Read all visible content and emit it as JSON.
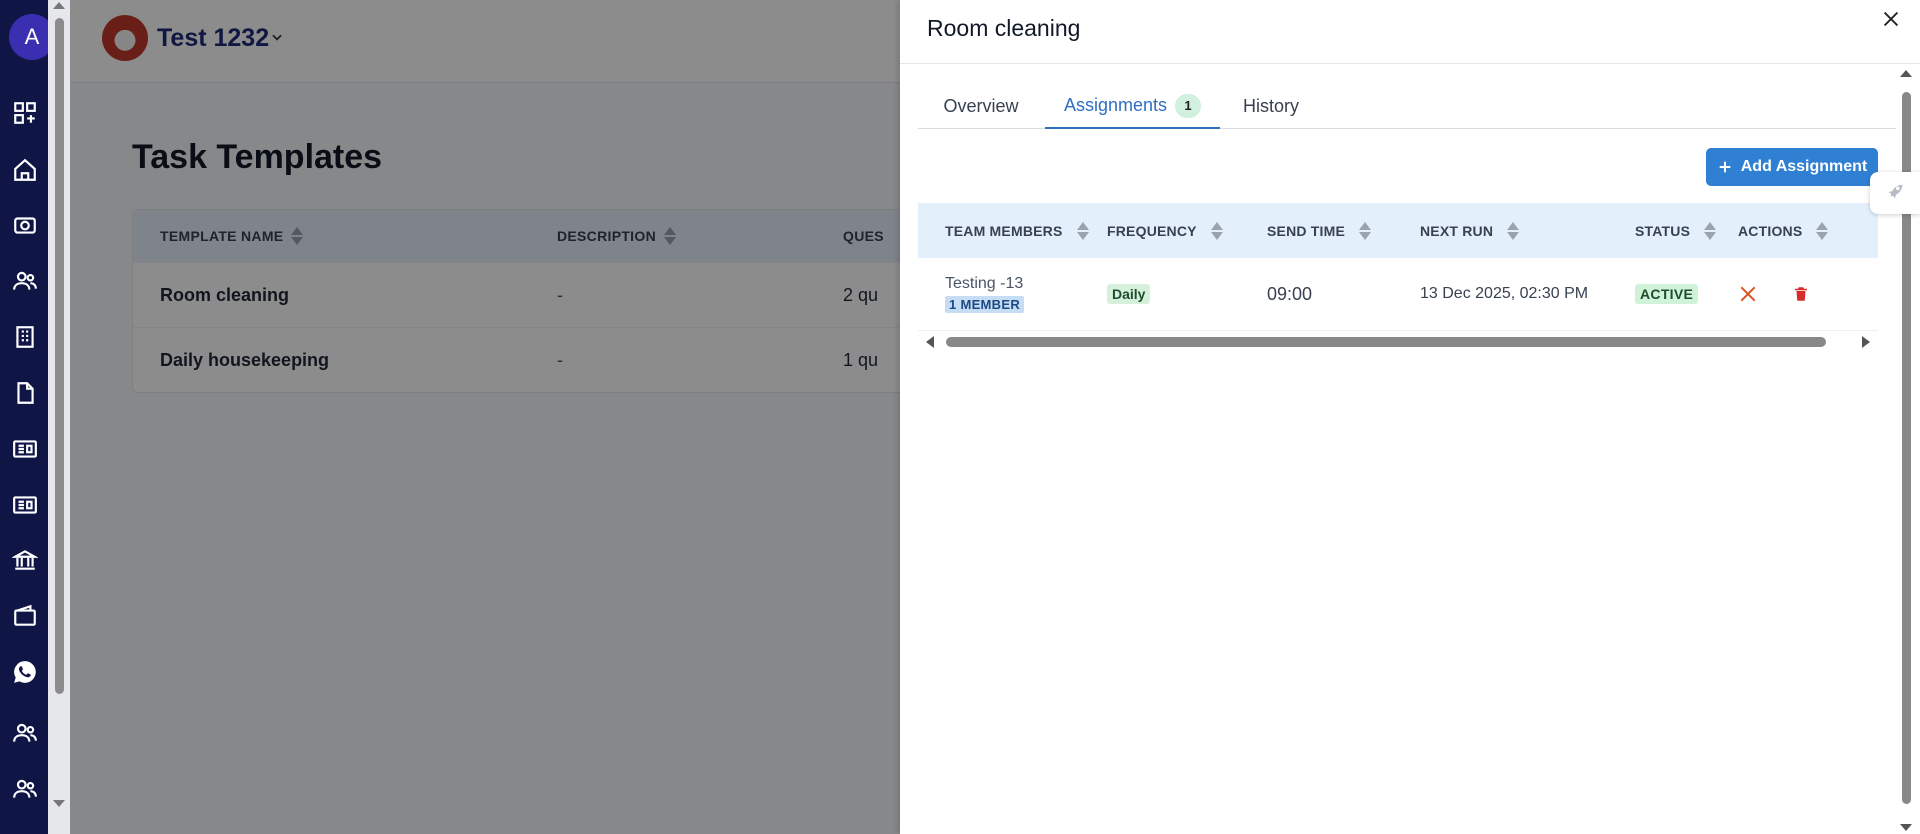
{
  "rail": {
    "avatar_letter": "A",
    "icons": [
      "dashboard-icon",
      "home-icon",
      "camera-icon",
      "users-icon",
      "building-icon",
      "document-icon",
      "id-card-icon",
      "id-card-icon",
      "bank-icon",
      "wallet-icon",
      "whatsapp-icon",
      "team-icon",
      "team-icon"
    ]
  },
  "header": {
    "org_name": "Test 1232"
  },
  "page": {
    "title": "Task Templates",
    "table": {
      "columns": [
        "TEMPLATE NAME",
        "DESCRIPTION",
        "QUES"
      ],
      "rows": [
        {
          "name": "Room cleaning",
          "description": "-",
          "questions": "2 qu"
        },
        {
          "name": "Daily housekeeping",
          "description": "-",
          "questions": "1 qu"
        }
      ]
    }
  },
  "drawer": {
    "title": "Room cleaning",
    "tabs": [
      {
        "label": "Overview"
      },
      {
        "label": "Assignments",
        "count": "1"
      },
      {
        "label": "History"
      }
    ],
    "active_tab": "Assignments",
    "add_button_label": "Add Assignment",
    "assignments": {
      "columns": [
        "TEAM MEMBERS",
        "FREQUENCY",
        "SEND TIME",
        "NEXT RUN",
        "STATUS",
        "ACTIONS"
      ],
      "rows": [
        {
          "team": "Testing -13",
          "members": "1 MEMBER",
          "frequency": "Daily",
          "send_time": "09:00",
          "next_run": "13 Dec 2025, 02:30 PM",
          "status": "ACTIVE"
        }
      ]
    }
  },
  "colors": {
    "rail_bg": "#0f1646",
    "accent": "#2f7fd3",
    "active_tab": "#2f6fc0",
    "status_active_bg": "#cff2d9"
  }
}
